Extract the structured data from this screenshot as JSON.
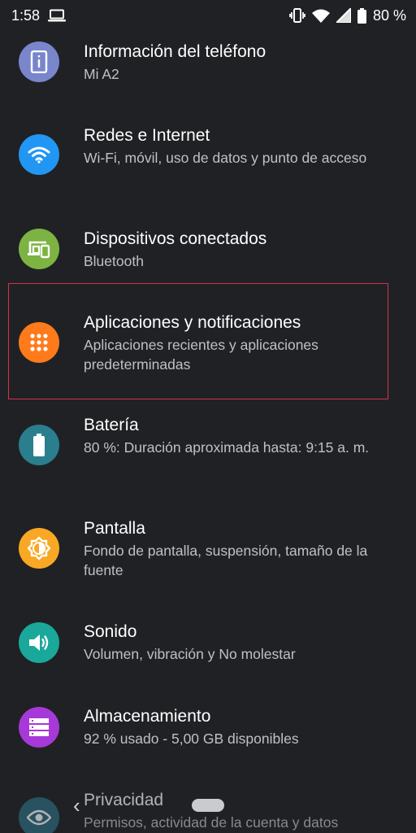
{
  "status_bar": {
    "time": "1:58",
    "battery_percent": "80 %",
    "icons": [
      "laptop-icon",
      "vibrate-icon",
      "wifi-icon",
      "signal-icon",
      "battery-icon"
    ]
  },
  "settings": {
    "items": [
      {
        "title": "Información del teléfono",
        "subtitle": "Mi A2",
        "icon": "phone-info-icon",
        "color": "#7986cb"
      },
      {
        "title": "Redes e Internet",
        "subtitle": "Wi-Fi, móvil, uso de datos y punto de acceso",
        "icon": "wifi-icon",
        "color": "#2196f3"
      },
      {
        "title": "Dispositivos conectados",
        "subtitle": "Bluetooth",
        "icon": "devices-icon",
        "color": "#7cb342"
      },
      {
        "title": "Aplicaciones y notificaciones",
        "subtitle": "Aplicaciones recientes y aplicaciones predeterminadas",
        "icon": "apps-grid-icon",
        "color": "#ff7a1a"
      },
      {
        "title": "Batería",
        "subtitle": "80 %: Duración aproximada hasta: 9:15 a. m.",
        "icon": "battery-icon",
        "color": "#2a7f8f"
      },
      {
        "title": "Pantalla",
        "subtitle": "Fondo de pantalla, suspensión, tamaño de la fuente",
        "icon": "brightness-icon",
        "color": "#f9a825"
      },
      {
        "title": "Sonido",
        "subtitle": "Volumen, vibración y No molestar",
        "icon": "volume-icon",
        "color": "#1aa89a"
      },
      {
        "title": "Almacenamiento",
        "subtitle": "92 % usado - 5,00 GB disponibles",
        "icon": "storage-icon",
        "color": "#a639d8"
      },
      {
        "title": "Privacidad",
        "subtitle": "Permisos, actividad de la cuenta y datos",
        "icon": "privacy-eye-icon",
        "color": "#2d6c80"
      }
    ]
  },
  "highlight": {
    "color": "#d2334d",
    "target": "Aplicaciones y notificaciones"
  }
}
